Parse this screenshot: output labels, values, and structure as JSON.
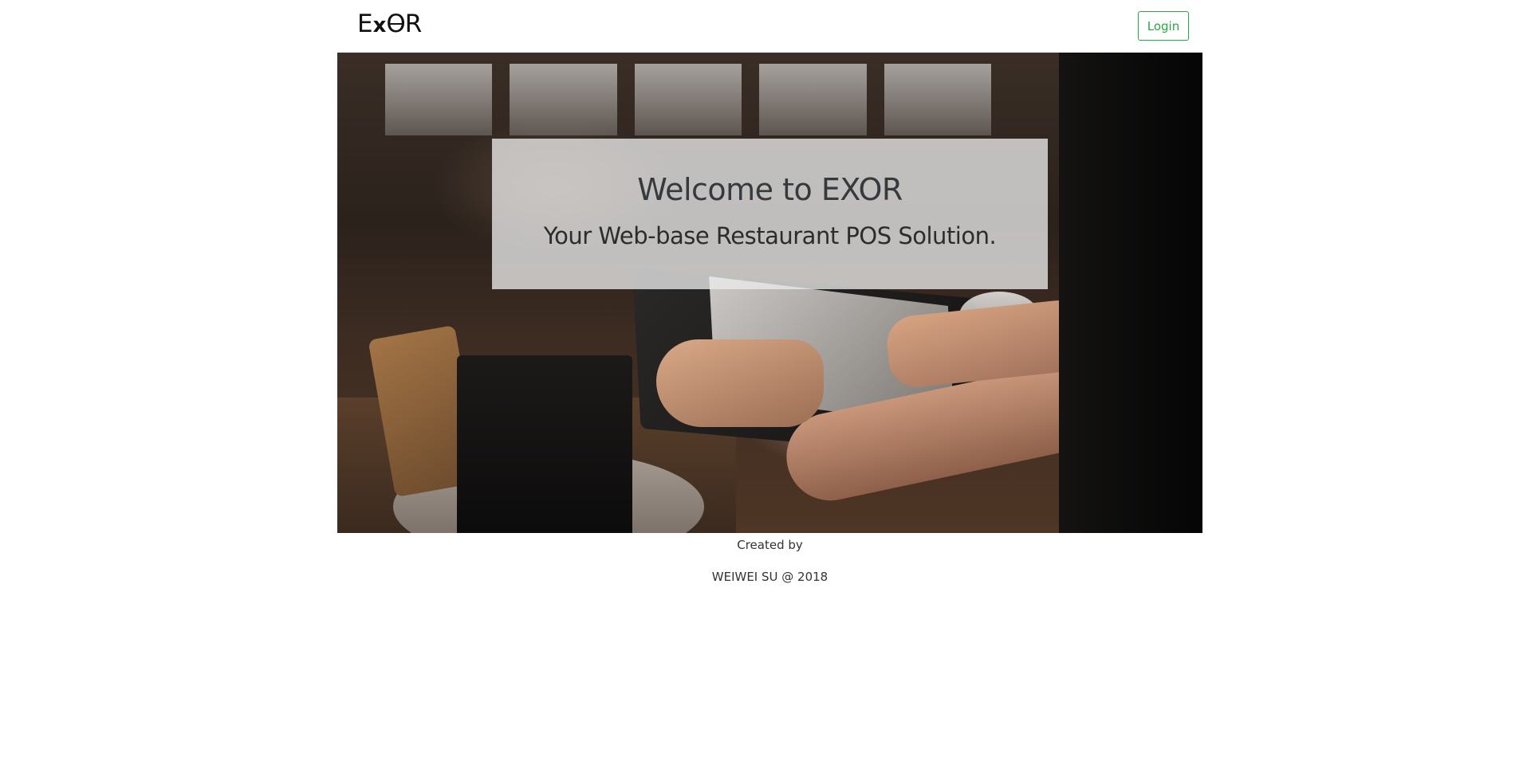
{
  "navbar": {
    "brand": {
      "letter_e": "E",
      "letter_x": "x",
      "letter_o": "O",
      "letter_r": "R"
    },
    "login_label": "Login"
  },
  "hero": {
    "title": "Welcome to EXOR",
    "subtitle": "Your Web-base Restaurant POS Solution."
  },
  "footer": {
    "created_by": "Created by",
    "author": "WEIWEI SU @ 2018"
  },
  "colors": {
    "accent": "#28a745",
    "text": "#373a3c"
  }
}
